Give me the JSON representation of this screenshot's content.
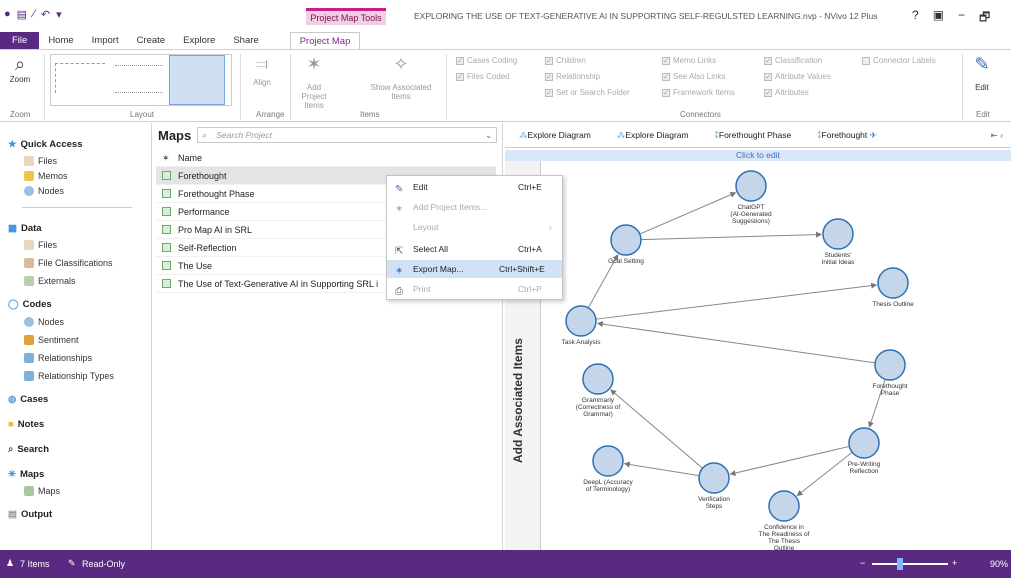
{
  "title_bar": {
    "context_tab": "Project Map Tools",
    "window_title": "EXPLORING THE USE OF TEXT-GENERATIVE AI IN SUPPORTING SELF-REGULSTED LEARNING.nvp - NVivo 12 Plus",
    "help": "?",
    "minimize": "−",
    "restore": "🗗"
  },
  "tabs": [
    "File",
    "Home",
    "Import",
    "Create",
    "Explore",
    "Share",
    "Project Map"
  ],
  "ribbon": {
    "zoom_label": "Zoom",
    "zoom_group": "Zoom",
    "layout_group": "Layout",
    "align_label": "Align",
    "arrange_group": "Arrange",
    "add_project_items": "Add Project Items",
    "show_associated_items": "Show Associated Items",
    "items_group": "Items",
    "connectors": [
      "Cases Coding",
      "Files Coded",
      "Children",
      "Relationship",
      "Set or Search Folder",
      "Memo Links",
      "See Also Links",
      "Framework Items",
      "Classification",
      "Attribute Values",
      "Attributes",
      "Connector Labels"
    ],
    "connectors_group": "Connectors",
    "edit_label": "Edit",
    "edit_group": "Edit"
  },
  "nav": {
    "quick_access": "Quick Access",
    "qa_items": [
      "Files",
      "Memos",
      "Nodes"
    ],
    "data": "Data",
    "data_items": [
      "Files",
      "File Classifications",
      "Externals"
    ],
    "codes": "Codes",
    "code_items": [
      "Nodes",
      "Sentiment",
      "Relationships",
      "Relationship Types"
    ],
    "cases": "Cases",
    "notes": "Notes",
    "search": "Search",
    "maps": "Maps",
    "map_items": [
      "Maps"
    ],
    "output": "Output"
  },
  "list": {
    "title": "Maps",
    "search_placeholder": "Search Project",
    "column_name": "Name",
    "rows": [
      "Forethought",
      "Forethought Phase",
      "Performance",
      "Pro Map AI in SRL",
      "Self-Reflection",
      "The Use",
      "The Use of Text-Generative AI in Supporting SRL i"
    ]
  },
  "context_menu": [
    {
      "label": "Edit",
      "shortcut": "Ctrl+E",
      "disabled": false
    },
    {
      "label": "Add Project Items...",
      "shortcut": "",
      "disabled": true
    },
    {
      "label": "Layout",
      "shortcut": "",
      "disabled": true
    },
    {
      "label": "Select All",
      "shortcut": "Ctrl+A",
      "disabled": false
    },
    {
      "label": "Export Map...",
      "shortcut": "Ctrl+Shift+E",
      "disabled": false,
      "highlighted": true
    },
    {
      "label": "Print",
      "shortcut": "Ctrl+P",
      "disabled": true
    }
  ],
  "diagram": {
    "tabs": [
      "Explore Diagram",
      "Explore Diagram",
      "Forethought Phase",
      "Forethought"
    ],
    "click_to_edit": "Click to edit",
    "add_associated_items": "Add Associated Items",
    "nodes": [
      {
        "id": "chatgpt",
        "label": "ChatGPT (AI-Generated Suggestions)"
      },
      {
        "id": "goal",
        "label": "Goal Setting"
      },
      {
        "id": "students",
        "label": "Students' Initial Ideas"
      },
      {
        "id": "thesis",
        "label": "Thesis Outline"
      },
      {
        "id": "task",
        "label": "Task Analysis"
      },
      {
        "id": "forephase",
        "label": "Forethought Phase"
      },
      {
        "id": "grammarly",
        "label": "Grammarly (Correctness of Grammar)"
      },
      {
        "id": "prewriting",
        "label": "Pre-Writing Reflection"
      },
      {
        "id": "deepl",
        "label": "DeepL (Accuracy of Terminology)"
      },
      {
        "id": "verification",
        "label": "Verification Steps"
      },
      {
        "id": "confidence",
        "label": "Confidence in The Readiness of The Thesis Outline"
      }
    ]
  },
  "status": {
    "items": "7 Items",
    "readonly": "Read-Only",
    "zoom": "90%",
    "zoom_fraction": 0.35
  }
}
